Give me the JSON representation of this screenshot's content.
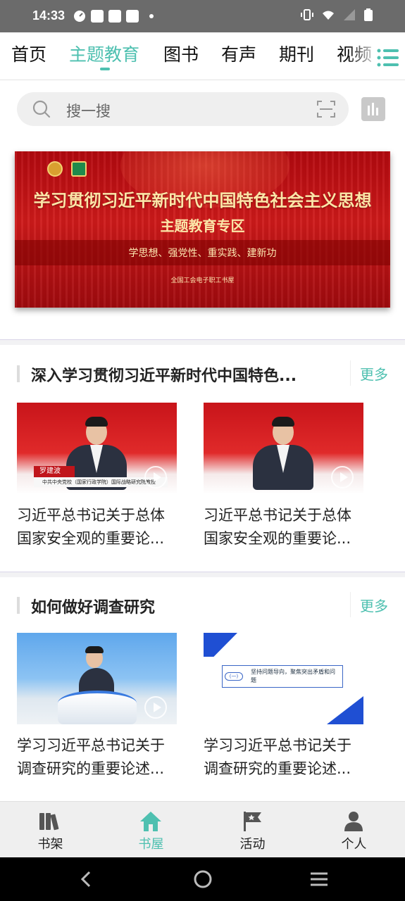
{
  "status_bar": {
    "time": "14:33"
  },
  "nav_tabs": [
    {
      "label": "首页"
    },
    {
      "label": "主题教育"
    },
    {
      "label": "图书"
    },
    {
      "label": "有声"
    },
    {
      "label": "期刊"
    },
    {
      "label": "视频"
    }
  ],
  "active_tab_index": 1,
  "search": {
    "placeholder": "搜一搜"
  },
  "banner": {
    "title": "学习贯彻习近平新时代中国特色社会主义思想",
    "subtitle": "主题教育专区",
    "slogan": "学思想、强党性、重实践、建新功",
    "organization": "全国工会电子职工书屋"
  },
  "sections": [
    {
      "title": "深入学习贯彻习近平新时代中国特色...",
      "more_label": "更多",
      "items": [
        {
          "caption_line1": "习近平总书记关于总体",
          "caption_line2": "国家安全观的重要论...",
          "speaker_name": "罗建波",
          "speaker_title": "中共中央党校（国家行政学院）国际战略研究院教授"
        },
        {
          "caption_line1": "习近平总书记关于总体",
          "caption_line2": "国家安全观的重要论..."
        }
      ]
    },
    {
      "title": "如何做好调查研究",
      "more_label": "更多",
      "items": [
        {
          "caption_line1": "学习习近平总书记关于",
          "caption_line2": "调查研究的重要论述..."
        },
        {
          "caption_line1": "学习习近平总书记关于",
          "caption_line2": "调查研究的重要论述...",
          "slide_tag": "(一)",
          "slide_text": "坚持问题导向，聚焦突出矛盾和问题"
        }
      ]
    }
  ],
  "bottom_tabs": [
    {
      "label": "书架",
      "icon": "bookshelf-icon"
    },
    {
      "label": "书屋",
      "icon": "home-icon"
    },
    {
      "label": "活动",
      "icon": "flag-icon"
    },
    {
      "label": "个人",
      "icon": "person-icon"
    }
  ],
  "active_bottom_tab_index": 1,
  "colors": {
    "accent": "#4ec0b0",
    "banner_red": "#c8141a",
    "status_bar": "#6b6b6b"
  }
}
